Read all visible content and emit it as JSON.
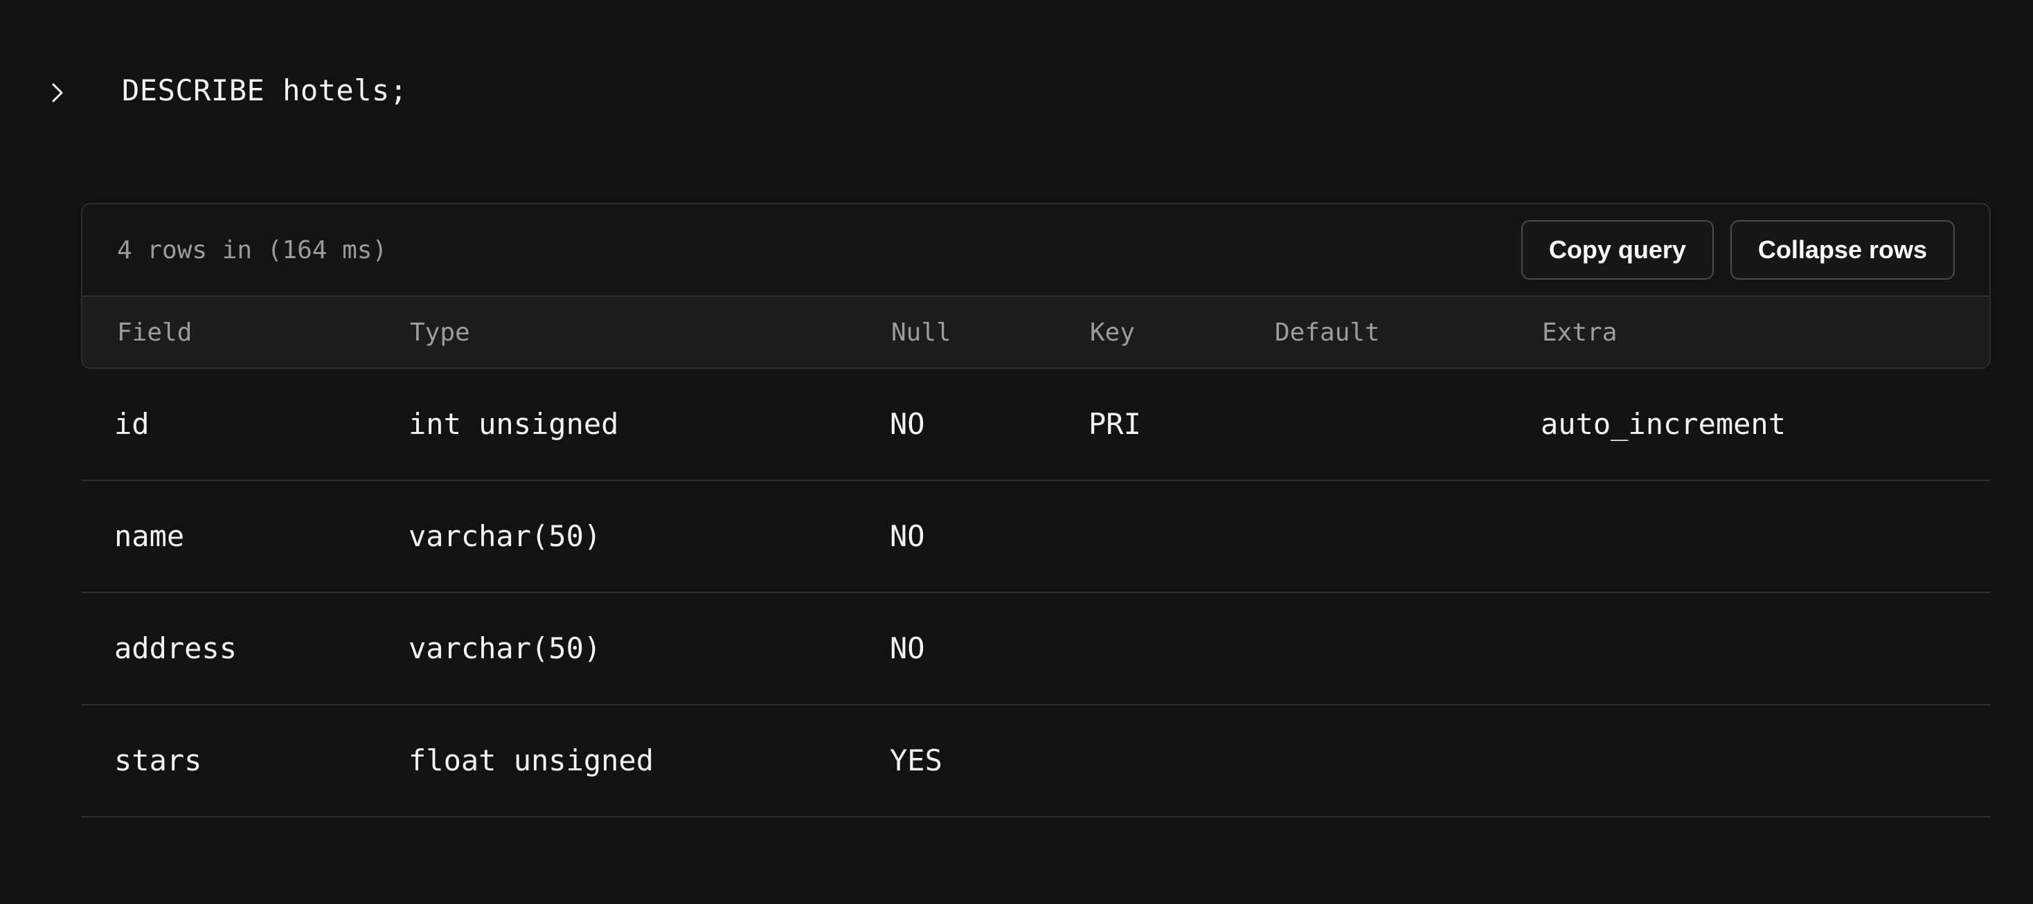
{
  "prompt": {
    "icon": "chevron-right-icon",
    "query": "DESCRIBE hotels;"
  },
  "result": {
    "summary": "4 rows in (164 ms)",
    "buttons": {
      "copy_query": "Copy query",
      "collapse_rows": "Collapse rows"
    },
    "columns": [
      "Field",
      "Type",
      "Null",
      "Key",
      "Default",
      "Extra"
    ],
    "rows": [
      {
        "field": "id",
        "type": "int unsigned",
        "null": "NO",
        "key": "PRI",
        "default": "",
        "extra": "auto_increment"
      },
      {
        "field": "name",
        "type": "varchar(50)",
        "null": "NO",
        "key": "",
        "default": "",
        "extra": ""
      },
      {
        "field": "address",
        "type": "varchar(50)",
        "null": "NO",
        "key": "",
        "default": "",
        "extra": ""
      },
      {
        "field": "stars",
        "type": "float unsigned",
        "null": "YES",
        "key": "",
        "default": "",
        "extra": ""
      }
    ]
  },
  "colors": {
    "background": "#121212",
    "border": "#2e2e2e",
    "header_bg": "#1c1c1c",
    "muted_text": "#9a9a9a",
    "text": "#f4f4f4"
  }
}
